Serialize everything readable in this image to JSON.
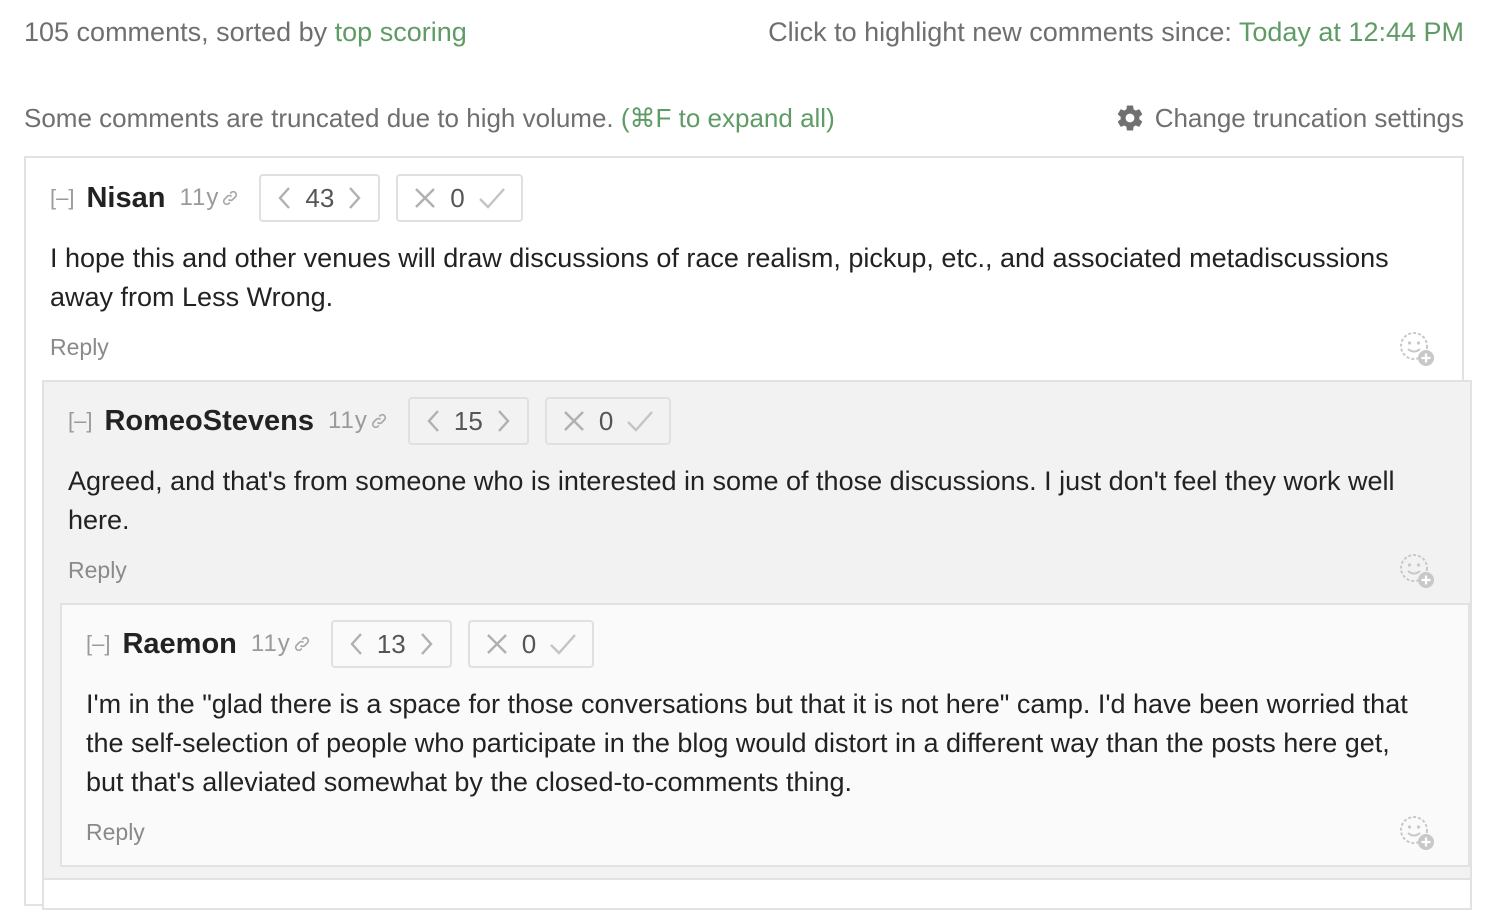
{
  "header": {
    "comment_count_text": "105 comments, sorted by ",
    "sort_label": "top scoring",
    "highlight_text": "Click to highlight new comments since: ",
    "highlight_time": "Today at 12:44 PM"
  },
  "truncation": {
    "notice": "Some comments are truncated due to high volume. ",
    "expand_label": "(⌘F to expand all)",
    "settings_label": "Change truncation settings"
  },
  "comments": [
    {
      "collapse": "[–]",
      "author": "Nisan",
      "age": "11y",
      "karma": "43",
      "agreement": "0",
      "body": "I hope this and other venues will draw discussions of race realism, pickup, etc., and associated metadiscussions away from Less Wrong.",
      "reply": "Reply"
    },
    {
      "collapse": "[–]",
      "author": "RomeoStevens",
      "age": "11y",
      "karma": "15",
      "agreement": "0",
      "body": "Agreed, and that's from someone who is interested in some of those discussions. I just don't feel they work well here.",
      "reply": "Reply"
    },
    {
      "collapse": "[–]",
      "author": "Raemon",
      "age": "11y",
      "karma": "13",
      "agreement": "0",
      "body": "I'm in the \"glad there is a space for those conversations but that it is not here\" camp. I'd have been worried that the self-selection of people who participate in the blog would distort in a different way than the posts here get, but that's alleviated somewhat by the closed-to-comments thing.",
      "reply": "Reply"
    }
  ],
  "colors": {
    "link_green": "#5f9b65",
    "muted_gray": "#6f6f6f",
    "border": "#e2e2e2"
  },
  "icons": [
    "gear-icon",
    "link-icon",
    "chevron-left-icon",
    "chevron-right-icon",
    "x-icon",
    "check-icon",
    "add-reaction-icon"
  ]
}
